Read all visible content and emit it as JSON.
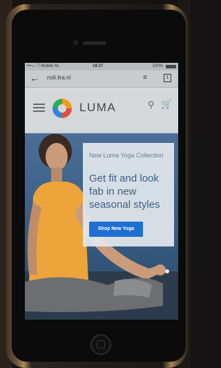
{
  "status_bar": {
    "carrier": "•••○○ T-Mobile NL",
    "time": "18:37",
    "battery": "100%"
  },
  "browser": {
    "back_icon": "back-arrow-icon",
    "url": "ns6.ilra.nl",
    "menu_icon": "reader-menu-icon",
    "tabs_count": "1"
  },
  "site_header": {
    "brand": "LUMA",
    "hamburger_icon": "hamburger-icon",
    "search_icon": "search-icon",
    "cart_icon": "cart-icon"
  },
  "hero": {
    "subtitle": "New Luma Yoga Collection",
    "headline": "Get fit and look fab in new seasonal styles",
    "cta_label": "Shop New Yoga"
  },
  "colors": {
    "cta_blue": "#1f6fd0",
    "headline_blue": "#3e5e86",
    "phone_trim": "#b28a55"
  }
}
